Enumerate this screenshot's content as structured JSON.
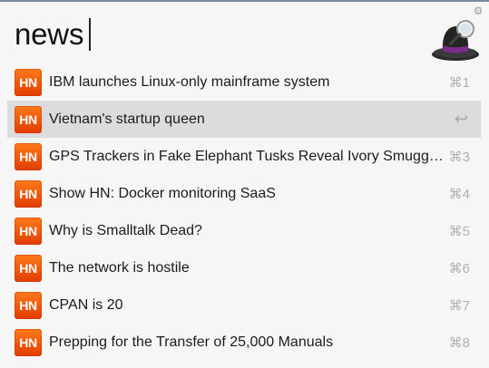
{
  "query": {
    "text": "news"
  },
  "results": [
    {
      "badge": "HN",
      "title": "IBM launches Linux-only mainframe system",
      "shortcut": "⌘1"
    },
    {
      "badge": "HN",
      "title": "Vietnam's startup queen",
      "shortcut": "↩"
    },
    {
      "badge": "HN",
      "title": "GPS Trackers in Fake Elephant Tusks Reveal Ivory Smuggling Route",
      "shortcut": "⌘3"
    },
    {
      "badge": "HN",
      "title": "Show HN: Docker monitoring SaaS",
      "shortcut": "⌘4"
    },
    {
      "badge": "HN",
      "title": "Why is Smalltalk Dead?",
      "shortcut": "⌘5"
    },
    {
      "badge": "HN",
      "title": "The network is hostile",
      "shortcut": "⌘6"
    },
    {
      "badge": "HN",
      "title": "CPAN is 20",
      "shortcut": "⌘7"
    },
    {
      "badge": "HN",
      "title": "Prepping for the Transfer of 25,000 Manuals",
      "shortcut": "⌘8"
    }
  ],
  "selected_index": 1,
  "icons": {
    "settings": "gear-icon",
    "app_logo": "alfred-hat-logo",
    "badge": "hacker-news-icon"
  },
  "colors": {
    "badge": "#ff6600",
    "selection": "#dcdcdc"
  }
}
